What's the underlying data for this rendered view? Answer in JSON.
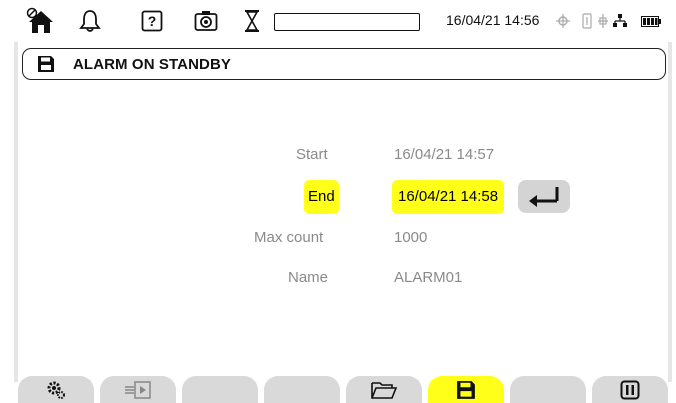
{
  "statusbar": {
    "icons": [
      "home-with-disabled-icon",
      "bell-icon",
      "help-icon",
      "camera-icon",
      "hourglass-icon"
    ],
    "progress_percent": 0,
    "datetime": "16/04/21 14:56",
    "right_icons": [
      "gps-icon",
      "usb-icon",
      "network-icon",
      "battery-icon"
    ]
  },
  "title": {
    "icon": "floppy-disk-icon",
    "text": "ALARM ON STANDBY"
  },
  "form": {
    "start": {
      "label": "Start",
      "value": "16/04/21 14:57"
    },
    "end": {
      "label": "End",
      "value": "16/04/21 14:58"
    },
    "max_count": {
      "label": "Max count",
      "value": "1000"
    },
    "name": {
      "label": "Name",
      "value": "ALARM01"
    }
  },
  "softkeys": [
    {
      "name": "settings-key",
      "icon": "gears-icon",
      "active": false
    },
    {
      "name": "program-key",
      "icon": "program-icon",
      "active": false
    },
    {
      "name": "empty-key-3",
      "icon": "",
      "active": false
    },
    {
      "name": "empty-key-4",
      "icon": "",
      "active": false
    },
    {
      "name": "open-folder-key",
      "icon": "folder-open-icon",
      "active": false
    },
    {
      "name": "save-key",
      "icon": "floppy-disk-icon",
      "active": true
    },
    {
      "name": "empty-key-7",
      "icon": "",
      "active": false
    },
    {
      "name": "pause-key",
      "icon": "pause-icon",
      "active": false
    }
  ],
  "colors": {
    "highlight": "#ffff1a",
    "key_background": "#d9d9d9",
    "label_gray": "#8a8a8a"
  }
}
